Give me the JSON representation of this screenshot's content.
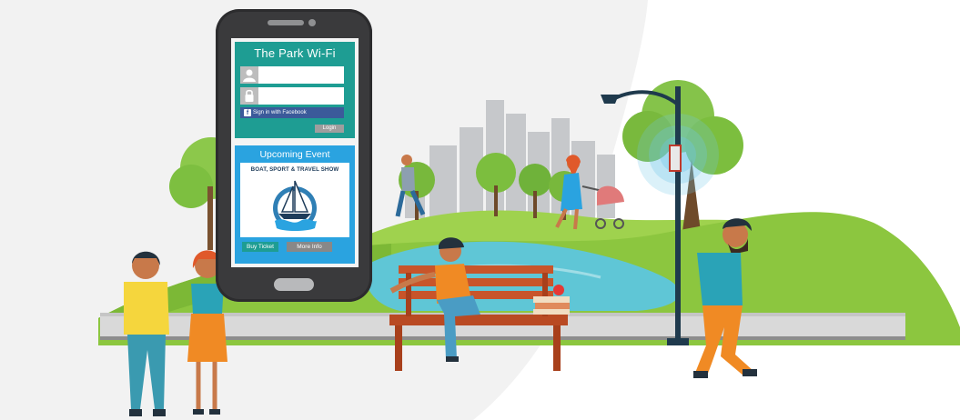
{
  "phone_screen": {
    "wifi_title": "The Park Wi-Fi",
    "username_icon": "user-icon",
    "password_icon": "lock-icon",
    "facebook_button": "Sign in with Facebook",
    "facebook_icon": "facebook-icon",
    "login_button": "Login",
    "event_heading": "Upcoming Event",
    "event_name": "BOAT, SPORT & TRAVEL SHOW",
    "event_logo_icon": "sailboat-logo-icon",
    "buy_button": "Buy Ticket",
    "info_button": "More Info"
  },
  "colors": {
    "wifi_panel": "#1e9d93",
    "event_panel": "#2aa3e0",
    "facebook_blue": "#3b5a9a",
    "phone_body": "#3a3a3c",
    "grass": "#8cc63f",
    "pond": "#5fc6d6",
    "bench": "#c8552a"
  }
}
